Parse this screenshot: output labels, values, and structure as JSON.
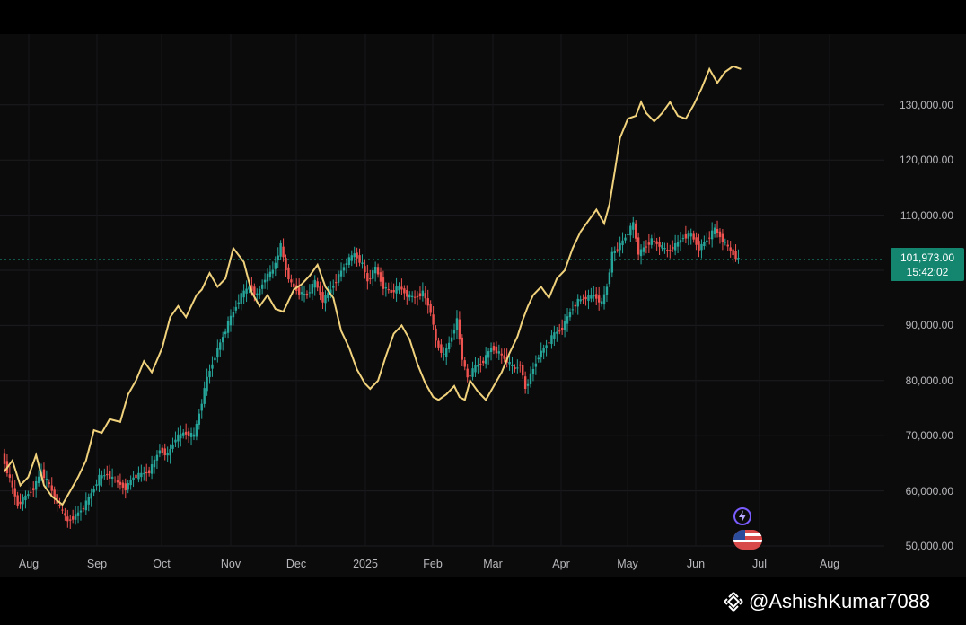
{
  "chart_data": {
    "type": "candlestick",
    "y_ticks": [
      "130,000.00",
      "120,000.00",
      "110,000.00",
      "90,000.00",
      "80,000.00",
      "70,000.00",
      "60,000.00",
      "50,000.00"
    ],
    "x_ticks": [
      "Aug",
      "Sep",
      "Oct",
      "Nov",
      "Dec",
      "2025",
      "Feb",
      "Mar",
      "Apr",
      "May",
      "Jun",
      "Jul",
      "Aug"
    ],
    "ylim": [
      45000,
      137000
    ],
    "current_price": {
      "value": 101973,
      "label": "101,973.00",
      "countdown": "15:42:02"
    },
    "grid": true,
    "series": [
      {
        "type": "candlestick",
        "up_color": "#26a69a",
        "down_color": "#ef5350",
        "close": [
          [
            0,
            66500
          ],
          [
            3,
            62000
          ],
          [
            6,
            57500
          ],
          [
            9,
            59000
          ],
          [
            12,
            60500
          ],
          [
            15,
            63500
          ],
          [
            18,
            61000
          ],
          [
            22,
            57000
          ],
          [
            25,
            54500
          ],
          [
            28,
            55500
          ],
          [
            31,
            57000
          ],
          [
            34,
            59500
          ],
          [
            37,
            62500
          ],
          [
            40,
            63000
          ],
          [
            44,
            61500
          ],
          [
            47,
            60500
          ],
          [
            50,
            62500
          ],
          [
            53,
            63000
          ],
          [
            56,
            63500
          ],
          [
            60,
            67500
          ],
          [
            63,
            66500
          ],
          [
            66,
            69500
          ],
          [
            69,
            70500
          ],
          [
            73,
            70000
          ],
          [
            75,
            74000
          ],
          [
            78,
            80500
          ],
          [
            81,
            84500
          ],
          [
            84,
            88000
          ],
          [
            87,
            91500
          ],
          [
            91,
            95500
          ],
          [
            94,
            97000
          ],
          [
            97,
            95500
          ],
          [
            100,
            98500
          ],
          [
            103,
            100000
          ],
          [
            106,
            104500
          ],
          [
            108,
            100000
          ],
          [
            110,
            97500
          ],
          [
            113,
            96000
          ],
          [
            116,
            95500
          ],
          [
            119,
            98000
          ],
          [
            122,
            94500
          ],
          [
            125,
            96500
          ],
          [
            128,
            99000
          ],
          [
            131,
            101500
          ],
          [
            134,
            103000
          ],
          [
            137,
            101000
          ],
          [
            139,
            98000
          ],
          [
            142,
            100500
          ],
          [
            145,
            97000
          ],
          [
            148,
            96000
          ],
          [
            151,
            97000
          ],
          [
            154,
            95500
          ],
          [
            157,
            95000
          ],
          [
            160,
            96000
          ],
          [
            163,
            92500
          ],
          [
            165,
            87000
          ],
          [
            168,
            84500
          ],
          [
            171,
            88000
          ],
          [
            173,
            91000
          ],
          [
            175,
            84000
          ],
          [
            177,
            80500
          ],
          [
            180,
            82500
          ],
          [
            183,
            83500
          ],
          [
            186,
            86000
          ],
          [
            189,
            85000
          ],
          [
            192,
            83500
          ],
          [
            195,
            82000
          ],
          [
            197,
            83000
          ],
          [
            199,
            78500
          ],
          [
            201,
            81000
          ],
          [
            204,
            84500
          ],
          [
            207,
            86500
          ],
          [
            210,
            88500
          ],
          [
            213,
            89500
          ],
          [
            216,
            92500
          ],
          [
            219,
            94500
          ],
          [
            222,
            95000
          ],
          [
            225,
            95500
          ],
          [
            228,
            94000
          ],
          [
            230,
            97000
          ],
          [
            232,
            103000
          ],
          [
            234,
            104000
          ],
          [
            237,
            106000
          ],
          [
            240,
            108500
          ],
          [
            242,
            103000
          ],
          [
            244,
            104000
          ],
          [
            247,
            105500
          ],
          [
            250,
            104500
          ],
          [
            253,
            103500
          ],
          [
            256,
            104500
          ],
          [
            259,
            106000
          ],
          [
            262,
            106500
          ],
          [
            265,
            104000
          ],
          [
            268,
            105500
          ],
          [
            271,
            107500
          ],
          [
            274,
            105500
          ],
          [
            277,
            103500
          ],
          [
            280,
            101973
          ]
        ],
        "close_x_unit": "days since Aug 2024"
      },
      {
        "type": "line",
        "color": "#f1d27c",
        "values": [
          [
            0,
            63500
          ],
          [
            3,
            65500
          ],
          [
            6,
            61000
          ],
          [
            9,
            62500
          ],
          [
            12,
            66500
          ],
          [
            15,
            61000
          ],
          [
            18,
            59000
          ],
          [
            22,
            57500
          ],
          [
            25,
            60000
          ],
          [
            28,
            62500
          ],
          [
            31,
            65500
          ],
          [
            34,
            71000
          ],
          [
            37,
            70500
          ],
          [
            40,
            73000
          ],
          [
            44,
            72500
          ],
          [
            47,
            77500
          ],
          [
            50,
            80000
          ],
          [
            53,
            83500
          ],
          [
            56,
            81500
          ],
          [
            60,
            86000
          ],
          [
            63,
            91500
          ],
          [
            66,
            93500
          ],
          [
            69,
            91500
          ],
          [
            73,
            95500
          ],
          [
            75,
            96500
          ],
          [
            78,
            99500
          ],
          [
            81,
            97000
          ],
          [
            84,
            98500
          ],
          [
            87,
            104000
          ],
          [
            91,
            101500
          ],
          [
            94,
            96000
          ],
          [
            97,
            93500
          ],
          [
            100,
            95500
          ],
          [
            103,
            93000
          ],
          [
            106,
            92500
          ],
          [
            108,
            94500
          ],
          [
            110,
            96500
          ],
          [
            113,
            97500
          ],
          [
            116,
            99000
          ],
          [
            119,
            101000
          ],
          [
            122,
            97000
          ],
          [
            125,
            95000
          ],
          [
            128,
            89000
          ],
          [
            131,
            86000
          ],
          [
            134,
            82000
          ],
          [
            137,
            79500
          ],
          [
            139,
            78500
          ],
          [
            142,
            80000
          ],
          [
            145,
            84500
          ],
          [
            148,
            88500
          ],
          [
            151,
            90000
          ],
          [
            154,
            87500
          ],
          [
            157,
            83000
          ],
          [
            160,
            79500
          ],
          [
            163,
            77000
          ],
          [
            165,
            76500
          ],
          [
            168,
            77500
          ],
          [
            171,
            79000
          ],
          [
            173,
            77000
          ],
          [
            175,
            76500
          ],
          [
            177,
            80000
          ],
          [
            180,
            78000
          ],
          [
            183,
            76500
          ],
          [
            186,
            79000
          ],
          [
            189,
            81500
          ],
          [
            192,
            85000
          ],
          [
            195,
            88000
          ],
          [
            197,
            91000
          ],
          [
            199,
            93500
          ],
          [
            201,
            95500
          ],
          [
            204,
            97000
          ],
          [
            207,
            95000
          ],
          [
            210,
            98500
          ],
          [
            213,
            100000
          ],
          [
            216,
            104000
          ],
          [
            219,
            107000
          ],
          [
            222,
            109000
          ],
          [
            225,
            111000
          ],
          [
            228,
            108500
          ],
          [
            230,
            112000
          ],
          [
            232,
            118000
          ],
          [
            234,
            124000
          ],
          [
            237,
            127500
          ],
          [
            240,
            128000
          ],
          [
            242,
            130500
          ],
          [
            244,
            128500
          ],
          [
            247,
            127000
          ],
          [
            250,
            128500
          ],
          [
            253,
            130500
          ],
          [
            256,
            128000
          ],
          [
            259,
            127500
          ],
          [
            262,
            130000
          ],
          [
            265,
            133000
          ],
          [
            268,
            136500
          ],
          [
            271,
            134000
          ],
          [
            274,
            136000
          ],
          [
            277,
            137000
          ],
          [
            280,
            136500
          ]
        ],
        "values_x_unit": "days since Aug 2024"
      }
    ]
  },
  "badge": {
    "price": "101,973.00",
    "countdown": "15:42:02"
  },
  "watermark": {
    "text": "@AshishKumar7088",
    "icon": "binance-icon"
  },
  "icons": [
    "lightning-icon",
    "us-flag-icon"
  ]
}
